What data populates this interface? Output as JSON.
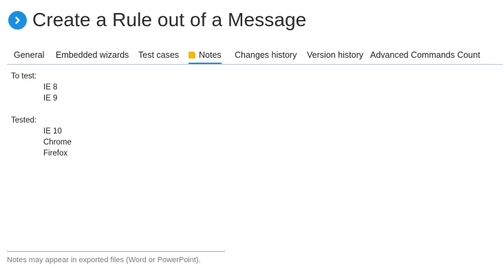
{
  "header": {
    "title": "Create a Rule out of a Message",
    "icon": "chevron-right-circle-icon",
    "accent_color": "#1a8fe0"
  },
  "tabs": [
    {
      "label": "General",
      "active": false
    },
    {
      "label": "Embedded wizards",
      "active": false
    },
    {
      "label": "Test cases",
      "active": false
    },
    {
      "label": "Notes",
      "active": true,
      "icon": "note-icon"
    },
    {
      "label": "Changes history",
      "active": false
    },
    {
      "label": "Version history",
      "active": false
    },
    {
      "label": "Advanced Commands Count",
      "active": false
    }
  ],
  "notes": {
    "sections": [
      {
        "heading": "To test:",
        "items": [
          "IE 8",
          "IE 9"
        ]
      },
      {
        "heading": "Tested:",
        "items": [
          "IE 10",
          "Chrome",
          "Firefox"
        ]
      }
    ]
  },
  "footer": {
    "text": "Notes may appear in exported files (Word or PowerPoint)."
  }
}
